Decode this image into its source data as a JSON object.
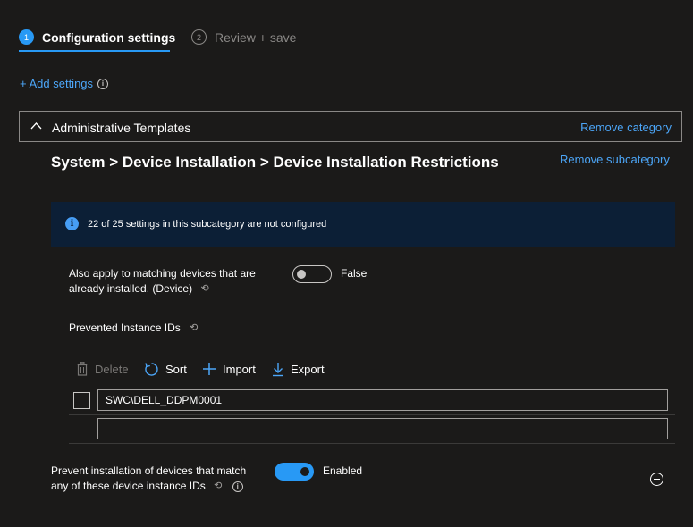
{
  "wizard": {
    "steps": [
      {
        "number": "1",
        "label": "Configuration settings"
      },
      {
        "number": "2",
        "label": "Review + save"
      }
    ]
  },
  "add_settings": {
    "label": "+ Add settings",
    "info": "i"
  },
  "category": {
    "title": "Administrative Templates",
    "remove_label": "Remove category"
  },
  "subcategory": {
    "path": "System > Device Installation > Device Installation Restrictions",
    "remove_label": "Remove subcategory"
  },
  "info_banner": {
    "icon": "i",
    "text": "22 of 25 settings in this subcategory are not configured"
  },
  "settings": {
    "also_apply": {
      "label_line1": "Also apply to matching devices that are",
      "label_line2": "already installed. (Device)",
      "value": false,
      "value_label": "False"
    },
    "prevented_ids": {
      "label": "Prevented Instance IDs",
      "toolbar": {
        "delete_label": "Delete",
        "sort_label": "Sort",
        "import_label": "Import",
        "export_label": "Export"
      },
      "rows": [
        {
          "value": "SWC\\DELL_DDPM0001"
        },
        {
          "value": "",
          "placeholder": ""
        }
      ]
    },
    "prevent_installation": {
      "label_line1": "Prevent installation of devices that match",
      "label_line2": "any of these device instance IDs",
      "value": true,
      "value_label": "Enabled"
    }
  },
  "colors": {
    "accent": "#2899f5",
    "link": "#4ca6f8",
    "background": "#1b1a19",
    "banner": "#0c1f36"
  },
  "icons": {
    "sync": "⟲",
    "delete": "🗑",
    "sort": "↻",
    "import": "+",
    "export": "↓",
    "chevron": "^"
  }
}
